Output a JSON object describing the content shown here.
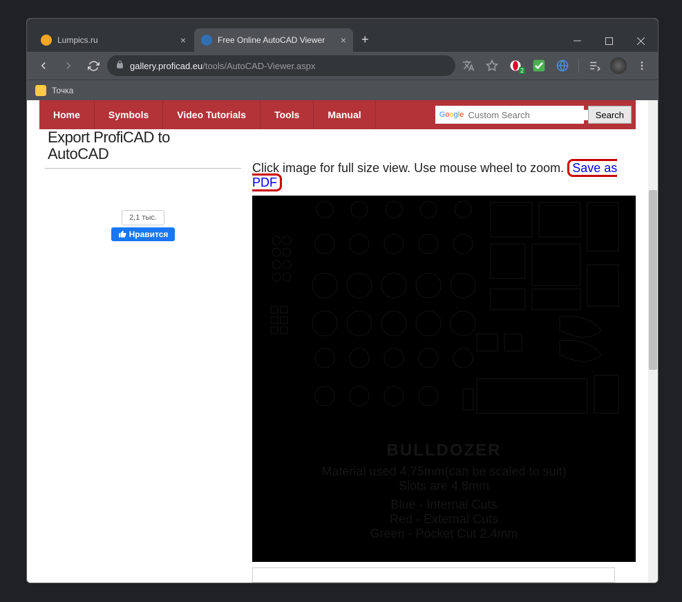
{
  "tabs": [
    {
      "title": "Lumpics.ru",
      "favcolor": "#f5a623"
    },
    {
      "title": "Free Online AutoCAD Viewer",
      "favcolor": "#2f6fb5"
    }
  ],
  "url_host": "gallery.proficad.eu",
  "url_path": "/tools/AutoCAD-Viewer.aspx",
  "ext_badge": "2",
  "bookmark": "Точка",
  "nav": {
    "home": "Home",
    "symbols": "Symbols",
    "tutorials": "Video Tutorials",
    "tools": "Tools",
    "manual": "Manual"
  },
  "search": {
    "placeholder": "Custom Search",
    "button": "Search"
  },
  "sidebar": {
    "header_l1": "Export ProfiCAD to",
    "header_l2": "AutoCAD",
    "like_count": "2,1 тыс.",
    "like_label": "Нравится"
  },
  "viewer": {
    "instruction": "Click image for full size view. Use mouse wheel to zoom.",
    "save_pdf": "Save as PDF"
  },
  "drawing": {
    "title": "BULLDOZER",
    "l1": "Material used 4.75mm(can be scaled to suit)",
    "l2": "Slots are 4.8mm",
    "l3": "Blue - Internal Cuts",
    "l4": "Red - External Cuts",
    "l5": "Green - Pocket Cut 2.4mm"
  }
}
